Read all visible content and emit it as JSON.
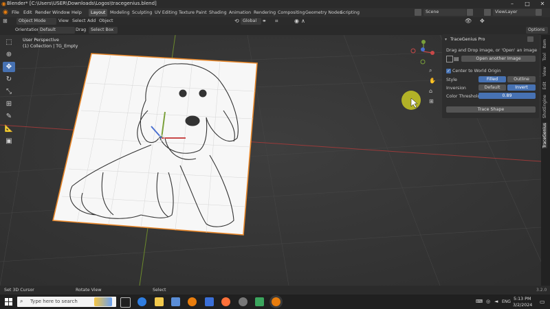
{
  "window": {
    "title": "Blender* [C:\\Users\\USER\\Downloads\\Logos\\tracegenius.blend]"
  },
  "menu": [
    "File",
    "Edit",
    "Render",
    "Window",
    "Help"
  ],
  "workspaces": [
    "Layout",
    "Modeling",
    "Sculpting",
    "UV Editing",
    "Texture Paint",
    "Shading",
    "Animation",
    "Rendering",
    "Compositing",
    "Geometry Nodes",
    "Scripting"
  ],
  "scene": {
    "name": "Scene",
    "view_layer": "ViewLayer"
  },
  "header": {
    "mode": "Object Mode",
    "menus": [
      "View",
      "Select",
      "Add",
      "Object"
    ],
    "transform": "Global",
    "options": "Options"
  },
  "toolheader": {
    "orientation_label": "Orientation",
    "orientation_value": "Default",
    "drag_label": "Drag",
    "drag_value": "Select Box"
  },
  "viewport": {
    "perspective": "User Perspective",
    "collection": "(1) Collection | TG_Empty"
  },
  "panel": {
    "title": "TraceGenius Pro",
    "hint": "Drag and Drop image, or 'Open' an image",
    "open_button": "Open another Image",
    "center_checkbox": "Center to World Origin",
    "style_label": "Style",
    "style_filled": "Filled",
    "style_outline": "Outline",
    "inversion_label": "Inversion",
    "inversion_default": "Default",
    "inversion_invert": "Invert",
    "threshold_label": "Color Threshold",
    "threshold_value": "0.89",
    "trace_button": "Trace Shape"
  },
  "side_tabs": [
    "Item",
    "Tool",
    "View",
    "Edit",
    "ShotEngine",
    "TraceGenius"
  ],
  "status": {
    "left": "Set 3D Cursor",
    "middle": "Rotate View",
    "right": "Select",
    "version": "3.2.0"
  },
  "taskbar": {
    "search_placeholder": "Type here to search",
    "lang": "ENG",
    "time": "5:13 PM",
    "date": "3/2/2024"
  },
  "colors": {
    "accent": "#4772b3",
    "selection": "#e8872a",
    "cursor_highlight": "#c8c824"
  }
}
